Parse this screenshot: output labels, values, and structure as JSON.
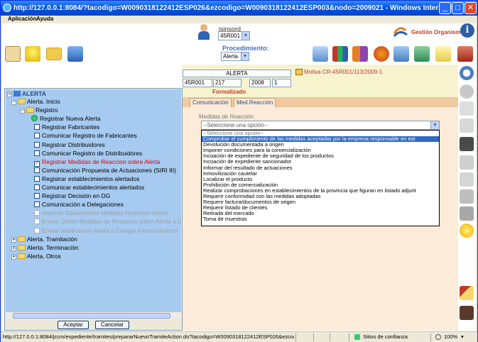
{
  "window": {
    "title": "http://127.0.0.1:8084/?tacodigo=W0090318122412ESP026&ezcodigo=W0090318122412ESP003&nodo=2009021 - Windows Internet Explorer",
    "controls": {
      "minimize": "_",
      "maximize": "□",
      "close": "✕"
    }
  },
  "menubar": {
    "items": [
      "Aplicación",
      "Ayuda"
    ]
  },
  "header": {
    "user_name": "jsinsord",
    "user_code": "45R001",
    "brand": "Gestión Organismo",
    "procedimiento_label": "Procedimiento:",
    "procedimiento_value": "Alerta"
  },
  "record": {
    "alerta_label": "ALERTA",
    "fields": [
      "45R001",
      "217",
      "2008",
      "1"
    ],
    "status": "Formalizado",
    "motiva": "Motiva CR-45R001/113/2009-1"
  },
  "tabs": [
    {
      "label": "Comunicación"
    },
    {
      "label": "Med.Reacción"
    }
  ],
  "medidas": {
    "label": "Medidas de Reacción",
    "selected": "--Seleccione una opción--",
    "options": [
      "--Seleccione una opción--",
      "Comprobar el cumplimiento de las medidas aceptadas por la empresa responsable en est",
      "Devolución documentada a origen",
      "Imponer condiciones para la comercialización",
      "Incoación de expediente de seguridad de los productos",
      "Incoación de expediente sancionador",
      "Informar del resultado de actuaciones",
      "Inmovilización cautelar",
      "Localizar el producto",
      "Prohibición de comercialización",
      "Realizar comprobaciones en establecimientos de la provincia que figuran en listado adjunt",
      "Requerir conformidad con las medidas adoptadas",
      "Requerir factura/documentos de origen",
      "Requerir listado de clientes",
      "Retirada del mercado",
      "Toma de muestras"
    ],
    "highlighted_index": 1
  },
  "tree": {
    "root": "ALERTA",
    "nodes": [
      {
        "label": "Alerta. Inicio"
      },
      {
        "label": "Registro"
      },
      {
        "label": "Registrar Nueva Alerta"
      },
      {
        "label": "Registrar Fabricantes"
      },
      {
        "label": "Comunicar Registro de Fabricantes"
      },
      {
        "label": "Registrar Distribuidores"
      },
      {
        "label": "Comunicar Registro de Distribuidores"
      },
      {
        "label": "Registrar Medidas de Reaccion sobre Alerta"
      },
      {
        "label": "Comunicación Propuesta de Actuaciones (SIRI III)"
      },
      {
        "label": "Registrar establecimientos alertados"
      },
      {
        "label": "Comunicar establecimientos alertados"
      },
      {
        "label": "Registrar Decisión en DG"
      },
      {
        "label": "Comunicación a Delegaciones"
      },
      {
        "label": "Imprimir Documentos Medidas Reaccion Alerta"
      },
      {
        "label": "Enviar Orden Medidas de Reaccion sobre Alerta a los PC/"
      },
      {
        "label": "Enviar Notificacion Alerta a Colegio Farmacéuticos"
      },
      {
        "label": "Alerta. Tramitación"
      },
      {
        "label": "Alerta. Terminación"
      },
      {
        "label": "Alerta. Otros"
      }
    ],
    "accept_label": "Aceptar",
    "cancel_label": "Cancelar"
  },
  "statusbar": {
    "url": "http://127.0.0.1:8084/jccm/expediente/tramites/prepararNuevoTramiteAction.do?tacodigo=W0090318122412ESP026&ezcodig",
    "zone": "Sitios de confianza",
    "zoom": "100%"
  }
}
